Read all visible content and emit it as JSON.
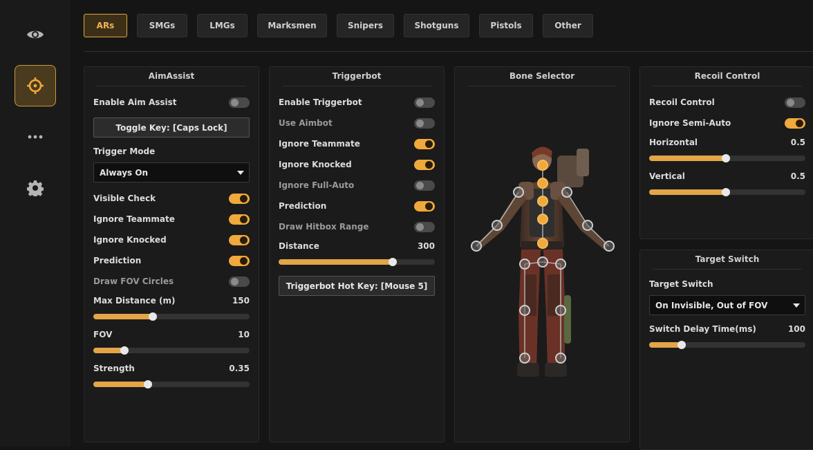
{
  "sidebar": {
    "items": [
      {
        "icon": "eye-icon",
        "active": false
      },
      {
        "icon": "crosshair-icon",
        "active": true
      },
      {
        "icon": "more-icon",
        "active": false
      },
      {
        "icon": "gear-icon",
        "active": false
      }
    ],
    "accent": "#e0a943"
  },
  "tabs": [
    {
      "label": "ARs",
      "active": true
    },
    {
      "label": "SMGs"
    },
    {
      "label": "LMGs"
    },
    {
      "label": "Marksmen"
    },
    {
      "label": "Snipers"
    },
    {
      "label": "Shotguns"
    },
    {
      "label": "Pistols"
    },
    {
      "label": "Other"
    }
  ],
  "aim_assist": {
    "title": "AimAssist",
    "enable": {
      "label": "Enable Aim Assist",
      "on": false
    },
    "toggle_key": "Toggle Key: [Caps Lock]",
    "trigger_mode_label": "Trigger Mode",
    "trigger_mode_value": "Always On",
    "visible_check": {
      "label": "Visible Check",
      "on": true
    },
    "ignore_teammate": {
      "label": "Ignore Teammate",
      "on": true
    },
    "ignore_knocked": {
      "label": "Ignore Knocked",
      "on": true
    },
    "prediction": {
      "label": "Prediction",
      "on": true
    },
    "draw_fov": {
      "label": "Draw FOV Circles",
      "on": false
    },
    "max_distance": {
      "label": "Max Distance (m)",
      "value": "150",
      "fraction": 0.38
    },
    "fov": {
      "label": "FOV",
      "value": "10",
      "fraction": 0.2
    },
    "strength": {
      "label": "Strength",
      "value": "0.35",
      "fraction": 0.35
    }
  },
  "triggerbot": {
    "title": "Triggerbot",
    "enable": {
      "label": "Enable Triggerbot",
      "on": false
    },
    "use_aimbot": {
      "label": "Use Aimbot",
      "on": false
    },
    "ignore_teammate": {
      "label": "Ignore Teammate",
      "on": true
    },
    "ignore_knocked": {
      "label": "Ignore Knocked",
      "on": true
    },
    "ignore_full_auto": {
      "label": "Ignore Full-Auto",
      "on": false
    },
    "prediction": {
      "label": "Prediction",
      "on": true
    },
    "draw_hitbox": {
      "label": "Draw Hitbox Range",
      "on": false
    },
    "distance": {
      "label": "Distance",
      "value": "300",
      "fraction": 0.73
    },
    "hot_key": "Triggerbot Hot Key: [Mouse 5]"
  },
  "bone_selector": {
    "title": "Bone Selector",
    "selected_bones": [
      "head",
      "neck",
      "upper-chest",
      "chest",
      "pelvis"
    ],
    "unselected_bones": [
      "left-shoulder",
      "right-shoulder",
      "left-elbow",
      "right-elbow",
      "left-hand",
      "right-hand",
      "left-hip",
      "right-hip",
      "spine-base",
      "left-knee",
      "right-knee",
      "left-foot",
      "right-foot"
    ]
  },
  "recoil_control": {
    "title": "Recoil Control",
    "enable": {
      "label": "Recoil Control",
      "on": false
    },
    "ignore_semi_auto": {
      "label": "Ignore Semi-Auto",
      "on": true
    },
    "horizontal": {
      "label": "Horizontal",
      "value": "0.5",
      "fraction": 0.49
    },
    "vertical": {
      "label": "Vertical",
      "value": "0.5",
      "fraction": 0.49
    }
  },
  "target_switch": {
    "title": "Target Switch",
    "label": "Target Switch",
    "value": "On Invisible, Out of FOV",
    "delay": {
      "label": "Switch Delay Time(ms)",
      "value": "100",
      "fraction": 0.21
    }
  }
}
